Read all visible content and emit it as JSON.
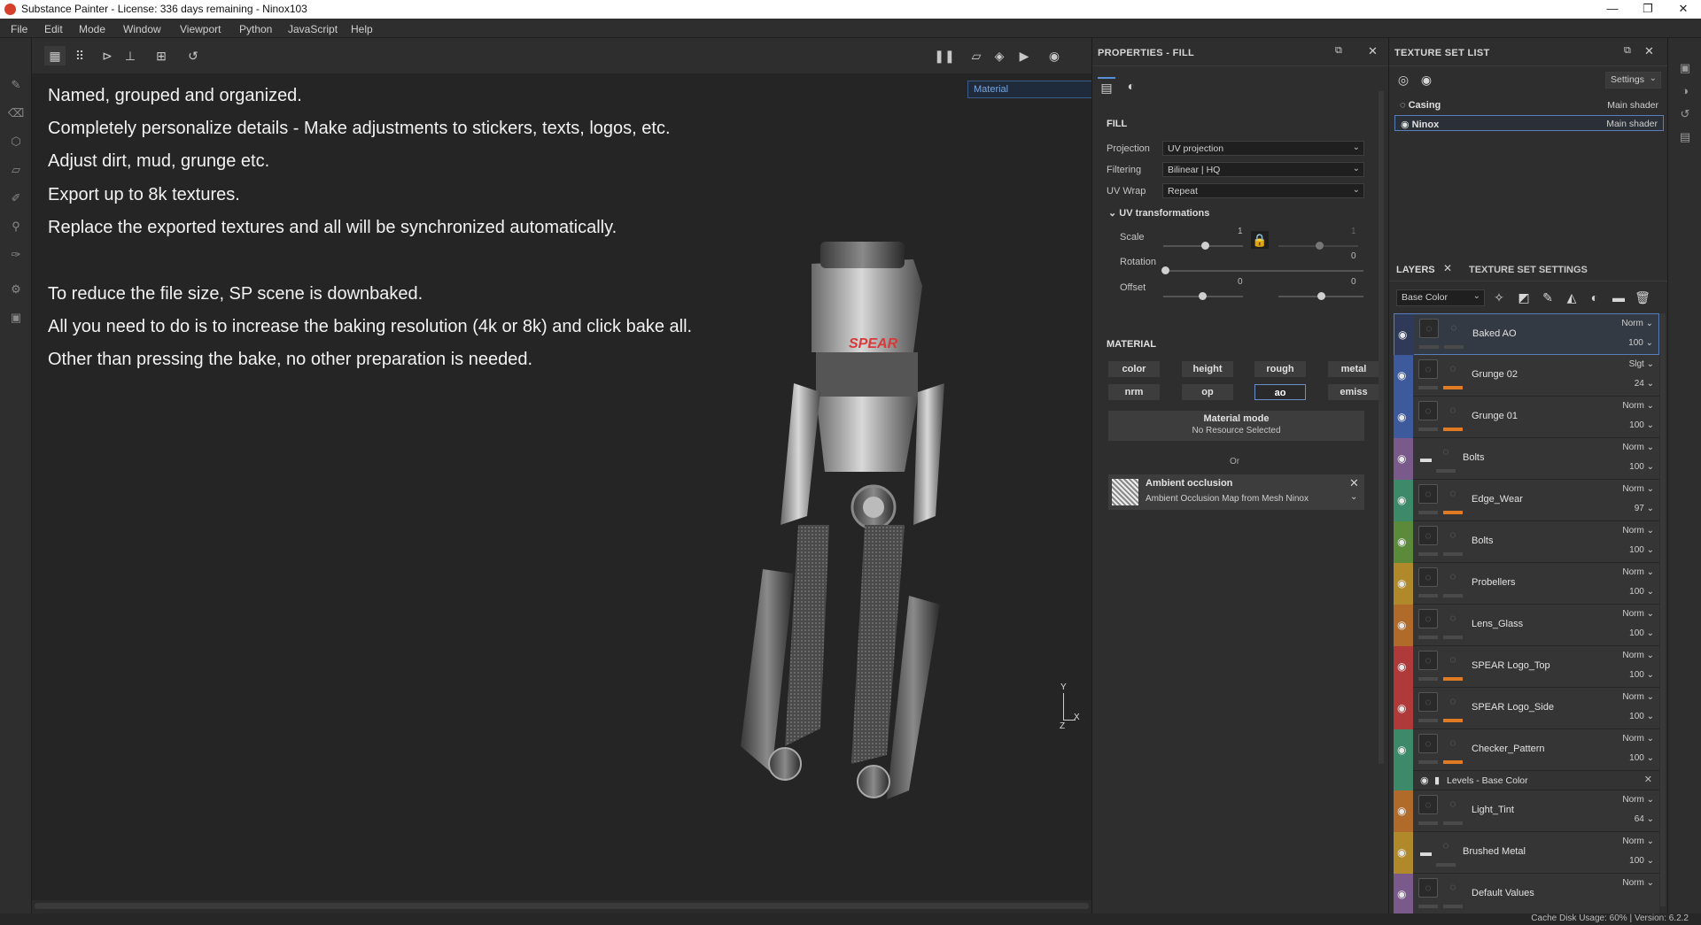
{
  "window": {
    "title": "Substance Painter - License: 336 days remaining - Ninox103"
  },
  "menu": [
    "File",
    "Edit",
    "Mode",
    "Window",
    "Viewport",
    "Python",
    "JavaScript",
    "Help"
  ],
  "viewport": {
    "material_mode": "Material",
    "lines": [
      "Named, grouped and organized.",
      "Completely personalize details - Make adjustments to stickers, texts, logos, etc.",
      "Adjust dirt, mud, grunge etc.",
      "Export up to 8k textures.",
      "Replace the exported textures and all will be synchronized automatically.",
      "To reduce the file size, SP scene is downbaked.",
      "All you need to do is to increase the baking resolution (4k or 8k) and click bake all.",
      "Other than pressing the bake, no other preparation is needed."
    ],
    "model_logo": "SPEAR",
    "axis": {
      "y": "Y",
      "x": "X",
      "z": "Z"
    }
  },
  "properties": {
    "title": "PROPERTIES - FILL",
    "fill_header": "FILL",
    "projection": {
      "label": "Projection",
      "value": "UV projection"
    },
    "filtering": {
      "label": "Filtering",
      "value": "Bilinear | HQ"
    },
    "uvwrap": {
      "label": "UV Wrap",
      "value": "Repeat"
    },
    "uv_transformations": "UV transformations",
    "scale": {
      "label": "Scale",
      "value_a": "1",
      "value_b": "1"
    },
    "rotation": {
      "label": "Rotation",
      "value": "0"
    },
    "offset": {
      "label": "Offset",
      "value_a": "0",
      "value_b": "0"
    },
    "material_header": "MATERIAL",
    "channels": [
      "color",
      "height",
      "rough",
      "metal",
      "nrm",
      "op",
      "ao",
      "emiss"
    ],
    "selected_channel": "ao",
    "material_mode": {
      "title": "Material mode",
      "subtitle": "No Resource Selected"
    },
    "or": "Or",
    "ao_resource": {
      "title": "Ambient occlusion",
      "subtitle": "Ambient Occlusion Map from Mesh Ninox"
    }
  },
  "texture_set_list": {
    "title": "TEXTURE SET LIST",
    "settings_label": "Settings",
    "rows": [
      {
        "name": "Casing",
        "shader": "Main shader"
      },
      {
        "name": "Ninox",
        "shader": "Main shader"
      }
    ]
  },
  "layers_panel": {
    "tab_layers": "LAYERS",
    "tab_settings": "TEXTURE SET SETTINGS",
    "channel_select": "Base Color",
    "layers": [
      {
        "name": "Baked AO",
        "blend": "Norm",
        "opacity": "100",
        "color": "#2f3a58",
        "mask": false
      },
      {
        "name": "Grunge 02",
        "blend": "Slgt",
        "opacity": "24",
        "color": "#3d5a9c",
        "mask": true
      },
      {
        "name": "Grunge 01",
        "blend": "Norm",
        "opacity": "100",
        "color": "#3d5a9c",
        "mask": true
      },
      {
        "name": "Bolts",
        "blend": "Norm",
        "opacity": "100",
        "color": "#7a5a8a",
        "mask": false
      },
      {
        "name": "Edge_Wear",
        "blend": "Norm",
        "opacity": "97",
        "color": "#3d8a6a",
        "mask": true
      },
      {
        "name": "Bolts",
        "blend": "Norm",
        "opacity": "100",
        "color": "#5a8a3a",
        "mask": false
      },
      {
        "name": "Probellers",
        "blend": "Norm",
        "opacity": "100",
        "color": "#b08a2a",
        "mask": false
      },
      {
        "name": "Lens_Glass",
        "blend": "Norm",
        "opacity": "100",
        "color": "#b06a2a",
        "mask": false
      },
      {
        "name": "SPEAR Logo_Top",
        "blend": "Norm",
        "opacity": "100",
        "color": "#b03a3a",
        "mask": true
      },
      {
        "name": "SPEAR Logo_Side",
        "blend": "Norm",
        "opacity": "100",
        "color": "#b03a3a",
        "mask": true
      },
      {
        "name": "Checker_Pattern",
        "blend": "Norm",
        "opacity": "100",
        "color": "#3d8a6a",
        "mask": true
      },
      {
        "name": "Light_Tint",
        "blend": "Norm",
        "opacity": "64",
        "color": "#b06a2a",
        "mask": false
      },
      {
        "name": "Brushed Metal",
        "blend": "Norm",
        "opacity": "100",
        "color": "#b08a2a",
        "mask": false
      },
      {
        "name": "Default Values",
        "blend": "Norm",
        "opacity": "",
        "color": "#7a5a8a",
        "mask": false
      }
    ],
    "effect": "Levels - Base Color"
  },
  "status": "Cache Disk Usage:   60% | Version: 6.2.2"
}
